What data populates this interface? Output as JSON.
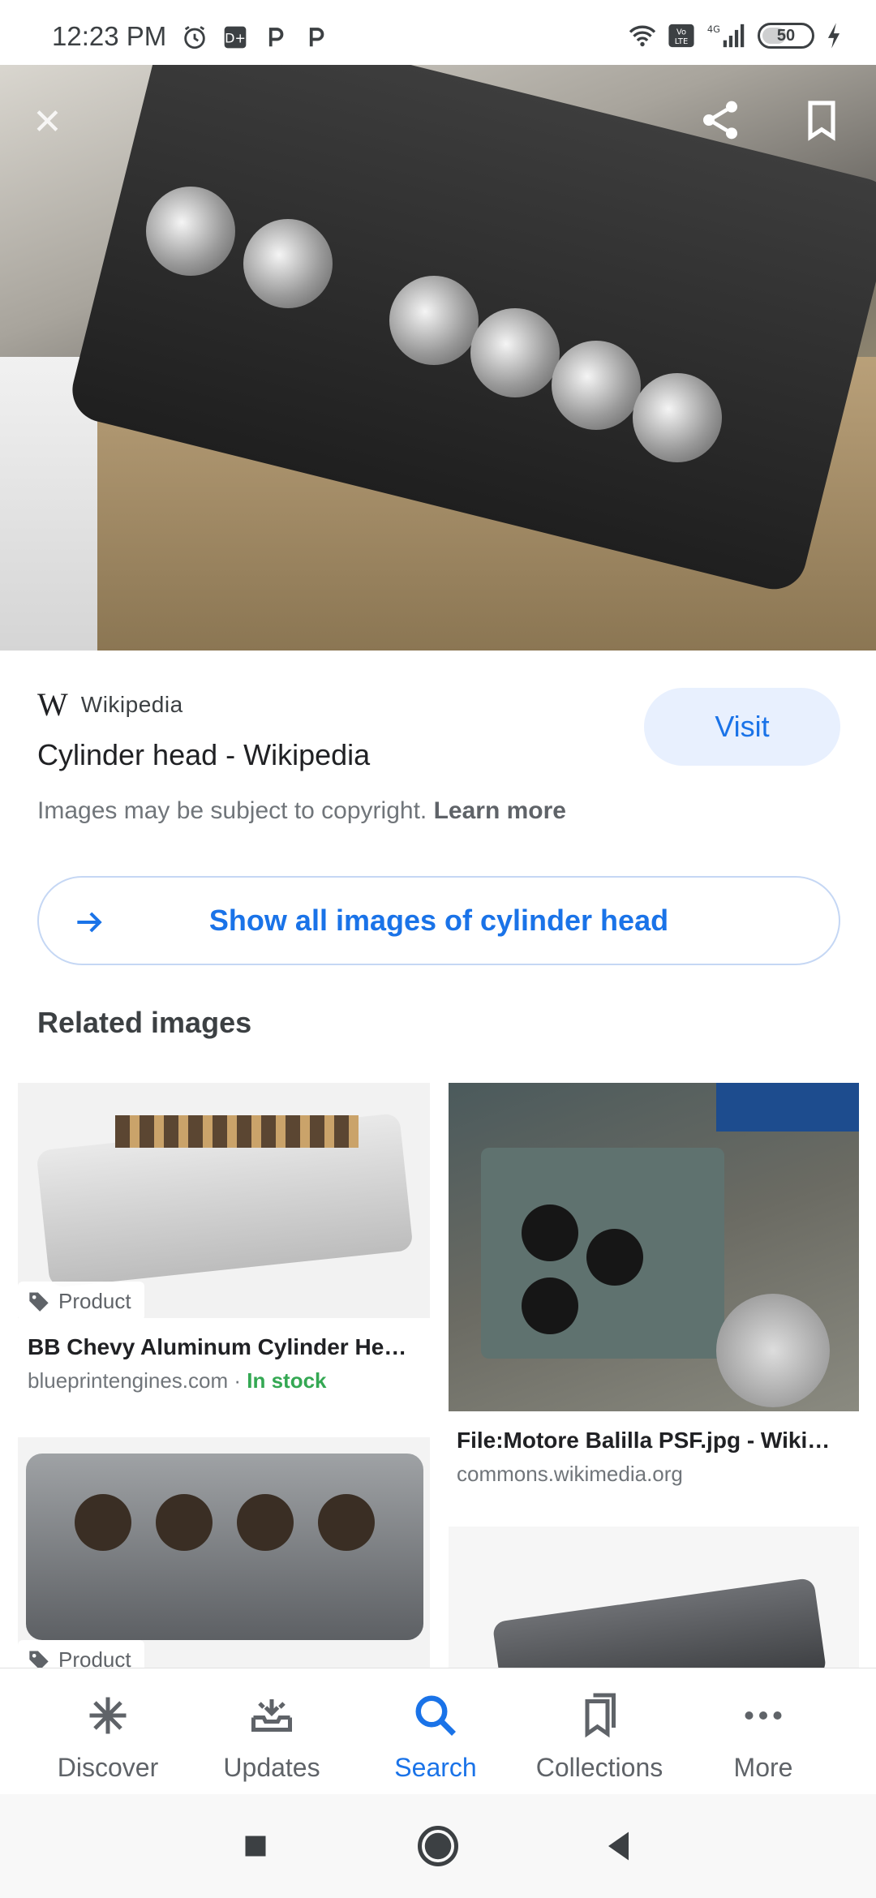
{
  "status_bar": {
    "time": "12:23 PM",
    "left_icons": [
      "alarm-icon",
      "disney-plus-icon",
      "p-app-icon",
      "p-app-icon"
    ],
    "right_icons": [
      "wifi-icon",
      "volte-icon",
      "signal-4g-icon",
      "battery-icon",
      "charging-icon"
    ],
    "network": "4G",
    "volte": "Vo LTE",
    "battery": "50"
  },
  "hero": {
    "close_icon": "close-icon",
    "share_icon": "share-icon",
    "bookmark_icon": "bookmark-icon"
  },
  "result": {
    "source_logo": "W",
    "source_name": "Wikipedia",
    "title": "Cylinder head - Wikipedia",
    "visit_label": "Visit",
    "copyright_text": "Images may be subject to copyright.",
    "learn_more": "Learn more"
  },
  "show_all": {
    "label": "Show all images of cylinder head"
  },
  "related": {
    "heading": "Related images",
    "items": [
      {
        "tag": "Product",
        "title": "BB Chevy Aluminum Cylinder He…",
        "domain": "blueprintengines.com",
        "separator": " · ",
        "stock": "In stock"
      },
      {
        "title": "File:Motore Balilla PSF.jpg - Wiki…",
        "domain": "commons.wikimedia.org"
      },
      {
        "tag": "Product"
      },
      {}
    ]
  },
  "bottom_nav": {
    "items": [
      {
        "label": "Discover",
        "icon": "asterisk-icon"
      },
      {
        "label": "Updates",
        "icon": "updates-icon"
      },
      {
        "label": "Search",
        "icon": "search-icon",
        "active": true
      },
      {
        "label": "Collections",
        "icon": "collections-icon"
      },
      {
        "label": "More",
        "icon": "more-icon"
      }
    ]
  },
  "colors": {
    "accent": "#1a73e8",
    "instock": "#34a853",
    "visit_bg": "#e8f0fe"
  }
}
